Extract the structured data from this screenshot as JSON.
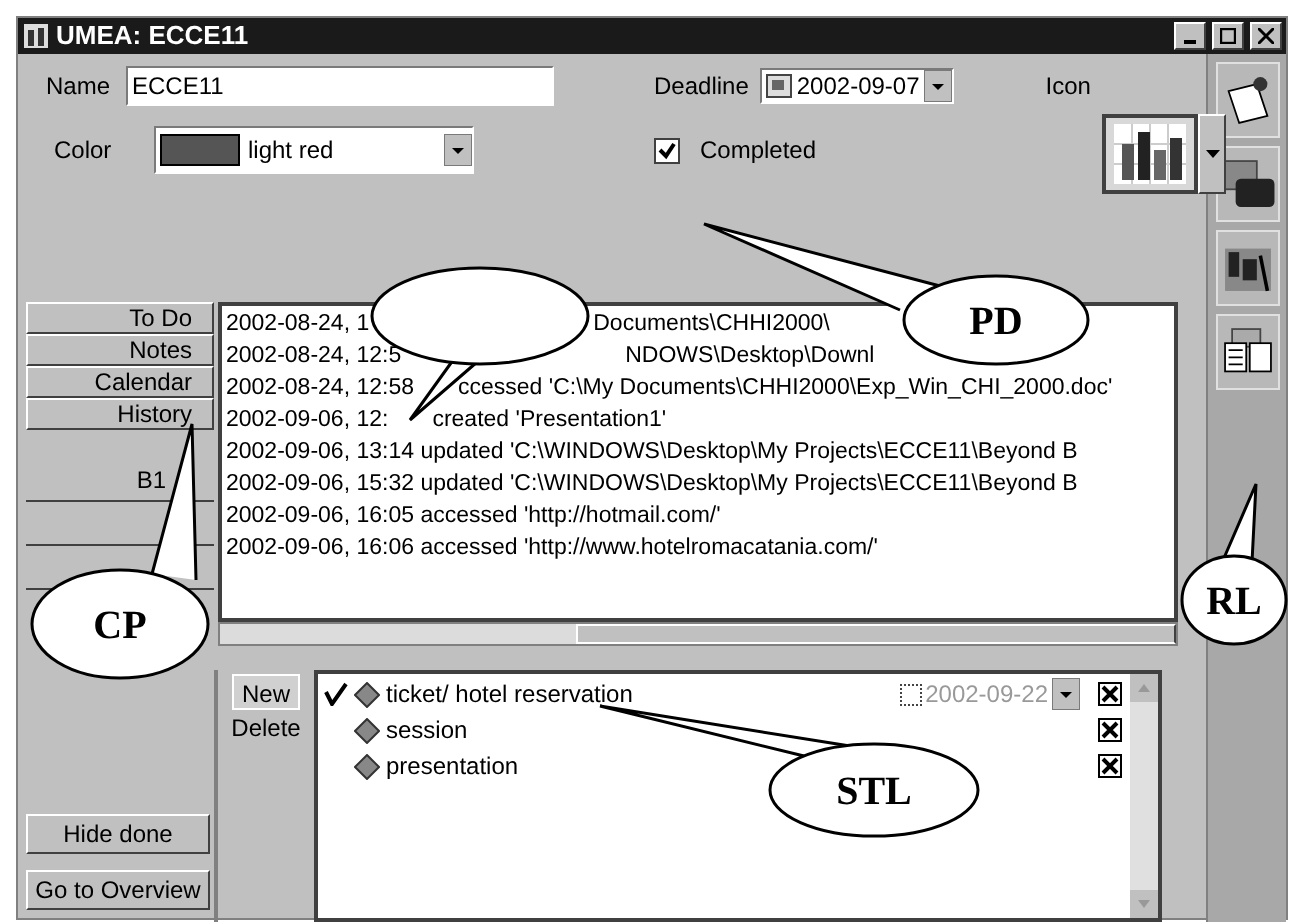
{
  "window": {
    "title": "UMEA: ECCE11"
  },
  "name_field": {
    "label": "Name",
    "value": "ECCE11"
  },
  "color_field": {
    "label": "Color",
    "value": "light red",
    "color": "#555555"
  },
  "deadline_field": {
    "label": "Deadline",
    "value": "2002-09-07"
  },
  "icon_picker": {
    "label": "Icon"
  },
  "completed": {
    "label": "Completed",
    "checked": true
  },
  "tabs": [
    {
      "label": "To Do"
    },
    {
      "label": "Notes"
    },
    {
      "label": "Calendar"
    },
    {
      "label": "History"
    }
  ],
  "tabs_lower": [
    {
      "label": "B1"
    }
  ],
  "history": [
    {
      "left": "2002-08-24, 1",
      "right": "Documents\\CHHI2000\\"
    },
    {
      "left": "2002-08-24, 12:5",
      "right": "NDOWS\\Desktop\\Downl"
    },
    {
      "left": "2002-08-24, 12:58",
      "right": "ccessed  'C:\\My Documents\\CHHI2000\\Exp_Win_CHI_2000.doc'"
    },
    {
      "left": "2002-09-06, 12:",
      "right": "created  'Presentation1'"
    },
    {
      "left": "2002-09-06, 13:14 updated  'C:\\WINDOWS\\Desktop\\My Projects\\ECCE11\\Beyond B"
    },
    {
      "left": "2002-09-06, 15:32 updated  'C:\\WINDOWS\\Desktop\\My Projects\\ECCE11\\Beyond B"
    },
    {
      "left": "2002-09-06, 16:05 accessed  'http://hotmail.com/'"
    },
    {
      "left": "2002-09-06, 16:06 accessed  'http://www.hotelromacatania.com/'"
    }
  ],
  "side_buttons": [
    "Hide done",
    "Go to Overview"
  ],
  "task_buttons": [
    "New",
    "Delete"
  ],
  "tasks": [
    {
      "label": "ticket/ hotel reservation",
      "done": true,
      "due": "2002-09-22"
    },
    {
      "label": "session",
      "done": false
    },
    {
      "label": "presentation",
      "done": false
    }
  ],
  "callouts": [
    {
      "kind": "blank"
    },
    {
      "kind": "labelled",
      "label": "PD"
    },
    {
      "kind": "labelled",
      "label": "CP"
    },
    {
      "kind": "labelled",
      "label": "RL"
    },
    {
      "kind": "labelled",
      "label": "STL"
    }
  ]
}
